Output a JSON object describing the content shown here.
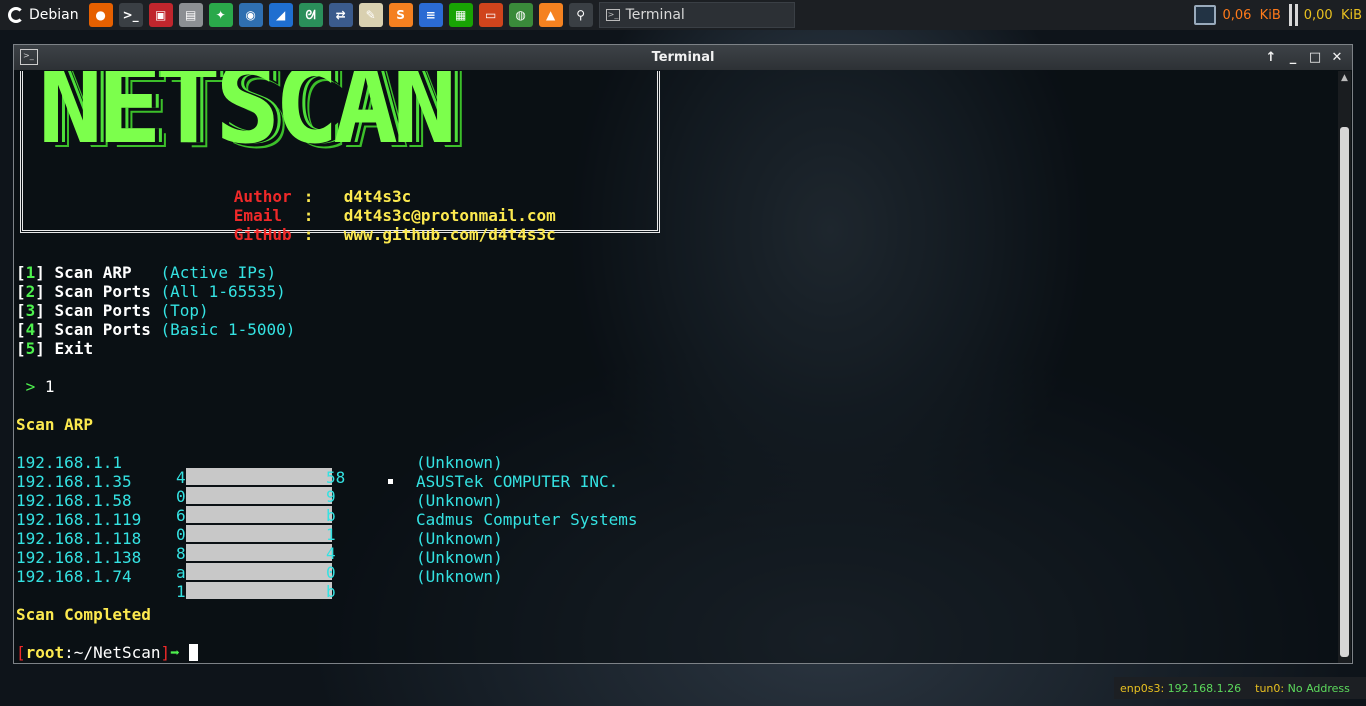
{
  "taskbar": {
    "menu_label": "Debian",
    "launchers": [
      {
        "name": "firefox-icon",
        "glyph": "●",
        "bg": "#e66000"
      },
      {
        "name": "terminal-icon",
        "glyph": ">_",
        "bg": "#3a3f44"
      },
      {
        "name": "task-manager-icon",
        "glyph": "▣",
        "bg": "#c0262d"
      },
      {
        "name": "calculator-icon",
        "glyph": "▤",
        "bg": "#8c8f93"
      },
      {
        "name": "network-tool-icon",
        "glyph": "✦",
        "bg": "#2aa84a"
      },
      {
        "name": "eye-icon",
        "glyph": "◉",
        "bg": "#2f6fb0"
      },
      {
        "name": "wireshark-icon",
        "glyph": "◢",
        "bg": "#1f6fd0"
      },
      {
        "name": "gecko-icon",
        "glyph": "ᘛ",
        "bg": "#2a8f5a"
      },
      {
        "name": "network-connections-icon",
        "glyph": "⇄",
        "bg": "#3b5b8c"
      },
      {
        "name": "text-editor-icon",
        "glyph": "✎",
        "bg": "#d9d0b0"
      },
      {
        "name": "sublime-icon",
        "glyph": "S",
        "bg": "#f48020"
      },
      {
        "name": "writer-icon",
        "glyph": "≡",
        "bg": "#2b6bd3"
      },
      {
        "name": "calc-icon",
        "glyph": "▦",
        "bg": "#18a303"
      },
      {
        "name": "impress-icon",
        "glyph": "▭",
        "bg": "#d0441c"
      },
      {
        "name": "browser-globe-icon",
        "glyph": "◍",
        "bg": "#3a8a3a"
      },
      {
        "name": "vlc-icon",
        "glyph": "▲",
        "bg": "#f58220"
      },
      {
        "name": "search-icon",
        "glyph": "⚲",
        "bg": "#3a3f44"
      }
    ],
    "task_title": "Terminal",
    "down_rate": "0,06  KiB",
    "up_rate": "0,00  KiB"
  },
  "window": {
    "title": "Terminal",
    "controls": {
      "up": "↑",
      "min": "_",
      "max": "□",
      "close": "✕"
    }
  },
  "terminal": {
    "logo": "NETSCAN",
    "author": {
      "label": "Author",
      "sep": ":",
      "value": "d4t4s3c"
    },
    "email": {
      "label": "Email",
      "sep": ":",
      "value": "d4t4s3c@protonmail.com"
    },
    "github": {
      "label": "GitHub",
      "sep": ":",
      "value": "www.github.com/d4t4s3c"
    },
    "menu": [
      {
        "num": "1",
        "name": "Scan ARP  ",
        "desc": "(Active IPs)"
      },
      {
        "num": "2",
        "name": "Scan Ports",
        "desc": "(All 1-65535)"
      },
      {
        "num": "3",
        "name": "Scan Ports",
        "desc": "(Top)"
      },
      {
        "num": "4",
        "name": "Scan Ports",
        "desc": "(Basic 1-5000)"
      },
      {
        "num": "5",
        "name": "Exit",
        "desc": ""
      }
    ],
    "prompt_symbol": ">",
    "input": "1",
    "section_title": "Scan ARP",
    "results": [
      {
        "ip": "192.168.1.1",
        "mac_first": "4",
        "mac_last": "58",
        "vendor": "(Unknown)"
      },
      {
        "ip": "192.168.1.35",
        "mac_first": "0",
        "mac_last": "9",
        "vendor": "ASUSTek COMPUTER INC."
      },
      {
        "ip": "192.168.1.58",
        "mac_first": "6",
        "mac_last": "b",
        "vendor": "(Unknown)"
      },
      {
        "ip": "192.168.1.119",
        "mac_first": "0",
        "mac_last": "1",
        "vendor": "Cadmus Computer Systems"
      },
      {
        "ip": "192.168.1.118",
        "mac_first": "84",
        "mac_last": "4",
        "vendor": "(Unknown)"
      },
      {
        "ip": "192.168.1.138",
        "mac_first": "a",
        "mac_last": "0",
        "vendor": "(Unknown)"
      },
      {
        "ip": "192.168.1.74",
        "mac_first": "1",
        "mac_last": "b",
        "vendor": "(Unknown)"
      }
    ],
    "completed": "Scan Completed",
    "shell_prompt": {
      "open": "[",
      "user": "root",
      "path": ":~/NetScan",
      "close": "]",
      "arrow": "➡"
    }
  },
  "status_bar": {
    "iface1": {
      "name": "enp0s3:",
      "addr": "192.168.1.26"
    },
    "iface2": {
      "name": "tun0:",
      "addr": "No Address"
    }
  }
}
